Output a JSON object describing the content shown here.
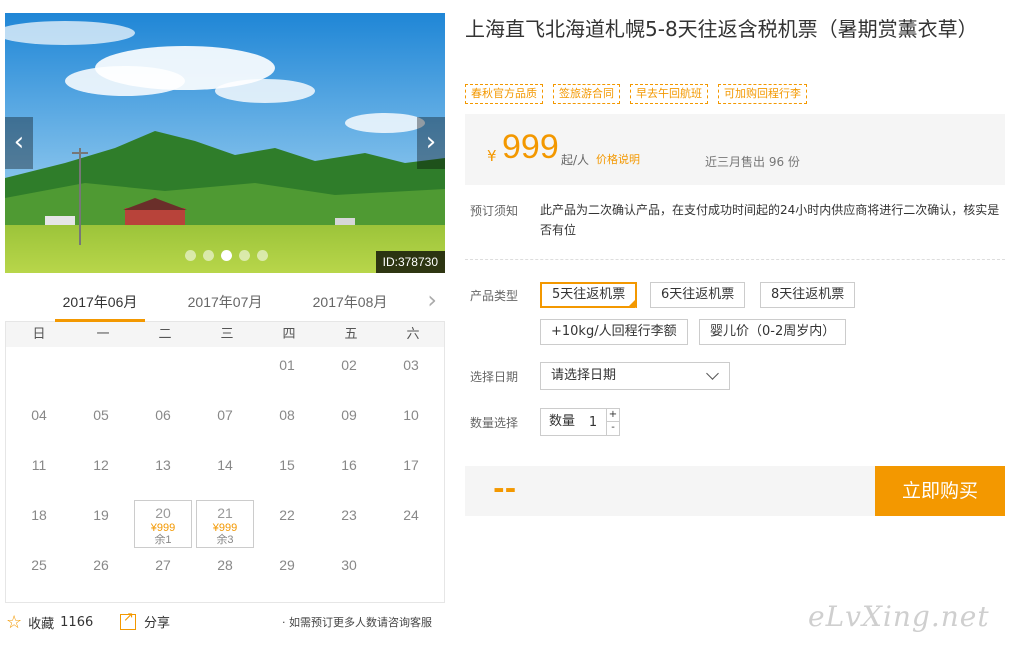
{
  "gallery": {
    "image_id": "ID:378730",
    "prev_icon": "chevron-left-icon",
    "next_icon": "chevron-right-icon",
    "dots": [
      false,
      false,
      true,
      false,
      false
    ]
  },
  "calendar": {
    "months": [
      "2017年06月",
      "2017年07月",
      "2017年08月"
    ],
    "active_month_index": 0,
    "weekdays": [
      "日",
      "一",
      "二",
      "三",
      "四",
      "五",
      "六"
    ],
    "rows": [
      [
        {
          "d": ""
        },
        {
          "d": ""
        },
        {
          "d": ""
        },
        {
          "d": ""
        },
        {
          "d": "01"
        },
        {
          "d": "02"
        },
        {
          "d": "03"
        }
      ],
      [
        {
          "d": "04"
        },
        {
          "d": "05"
        },
        {
          "d": "06"
        },
        {
          "d": "07"
        },
        {
          "d": "08"
        },
        {
          "d": "09"
        },
        {
          "d": "10"
        }
      ],
      [
        {
          "d": "11"
        },
        {
          "d": "12"
        },
        {
          "d": "13"
        },
        {
          "d": "14"
        },
        {
          "d": "15"
        },
        {
          "d": "16"
        },
        {
          "d": "17"
        }
      ],
      [
        {
          "d": "18"
        },
        {
          "d": "19"
        },
        {
          "d": "20",
          "price": "¥999",
          "left": "余1"
        },
        {
          "d": "21",
          "price": "¥999",
          "left": "余3"
        },
        {
          "d": "22"
        },
        {
          "d": "23"
        },
        {
          "d": "24"
        }
      ],
      [
        {
          "d": "25"
        },
        {
          "d": "26"
        },
        {
          "d": "27"
        },
        {
          "d": "28"
        },
        {
          "d": "29"
        },
        {
          "d": "30"
        },
        {
          "d": ""
        }
      ]
    ]
  },
  "footer": {
    "favorite_label": "收藏",
    "favorite_count": "1166",
    "share_label": "分享",
    "consult_text": "· 如需预订更多人数请咨询客服"
  },
  "product": {
    "title": "上海直飞北海道札幌5-8天往返含税机票（暑期赏薰衣草）",
    "tags": [
      "春秋官方品质",
      "签旅游合同",
      "早去午回航班",
      "可加购回程行李"
    ],
    "price_currency": "¥",
    "price_value": "999",
    "price_unit": "起/人",
    "price_note": "价格说明",
    "sold_text": "近三月售出 96 份",
    "notice_label": "预订须知",
    "notice_text": "此产品为二次确认产品，在支付成功时间起的24小时内供应商将进行二次确认，核实是否有位",
    "type_label": "产品类型",
    "type_options": [
      "5天往返机票",
      "6天往返机票",
      "8天往返机票",
      "+10kg/人回程行李额",
      "婴儿价（0-2周岁内）"
    ],
    "selected_type_index": 0,
    "date_label": "选择日期",
    "date_placeholder": "请选择日期",
    "qty_label": "数量选择",
    "qty_inner_label": "数量",
    "qty_value": "1",
    "qty_plus": "+",
    "qty_minus": "-",
    "total_text": "--",
    "buy_label": "立即购买"
  },
  "watermark": "eLvXing.net",
  "colors": {
    "accent": "#f39800",
    "panel": "#f5f5f5"
  }
}
